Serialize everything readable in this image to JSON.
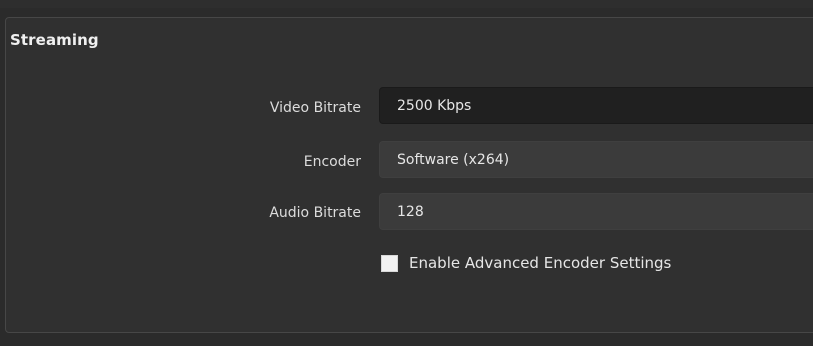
{
  "streaming": {
    "title": "Streaming",
    "video_bitrate": {
      "label": "Video Bitrate",
      "value": "2500 Kbps"
    },
    "encoder": {
      "label": "Encoder",
      "value": "Software (x264)"
    },
    "audio_bitrate": {
      "label": "Audio Bitrate",
      "value": "128"
    },
    "advanced_encoder": {
      "label": "Enable Advanced Encoder Settings",
      "checked": false
    }
  },
  "colors": {
    "background": "#2b2b2b",
    "group_background": "#303030",
    "input_background": "#202020",
    "select_background": "#3b3b3b",
    "text": "#dcdcdc",
    "checkbox": "#f2f2f2"
  }
}
